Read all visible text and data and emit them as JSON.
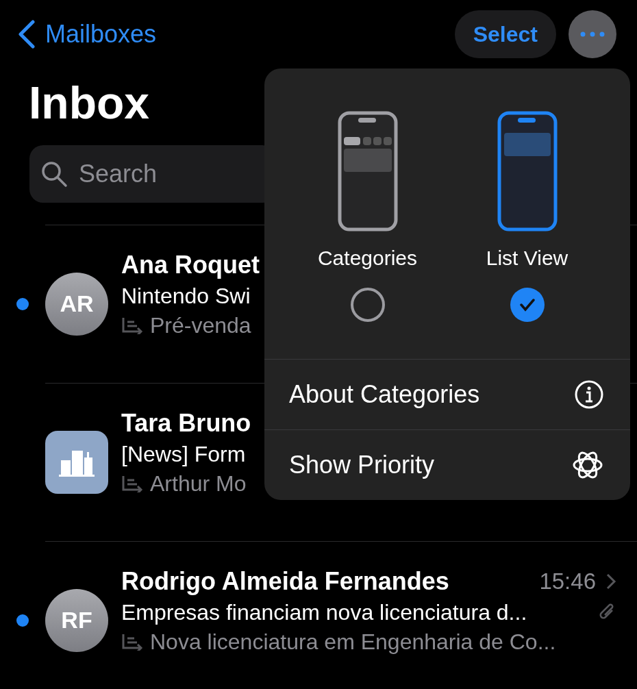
{
  "nav": {
    "back_label": "Mailboxes",
    "select_label": "Select"
  },
  "title": "Inbox",
  "search": {
    "placeholder": "Search"
  },
  "messages": [
    {
      "unread": true,
      "avatar": {
        "kind": "initials",
        "initials": "AR"
      },
      "sender": "Ana Roquet",
      "subject": "Nintendo Swi",
      "preview": "Pré-venda",
      "attachment": false
    },
    {
      "unread": false,
      "avatar": {
        "kind": "building"
      },
      "sender": "Tara Bruno",
      "subject": "[News] Form",
      "preview": "Arthur Mo",
      "attachment": false
    },
    {
      "unread": true,
      "avatar": {
        "kind": "initials",
        "initials": "RF"
      },
      "sender": "Rodrigo Almeida Fernandes",
      "time": "15:46",
      "subject": "Empresas financiam nova licenciatura d...",
      "preview": "Nova licenciatura em Engenharia de Co...",
      "attachment": true
    }
  ],
  "menu": {
    "views": [
      {
        "kind": "categories",
        "label": "Categories",
        "selected": false
      },
      {
        "kind": "list",
        "label": "List View",
        "selected": true
      }
    ],
    "items": [
      {
        "label": "About Categories",
        "kind": "info"
      },
      {
        "label": "Show Priority",
        "kind": "priority"
      }
    ]
  }
}
